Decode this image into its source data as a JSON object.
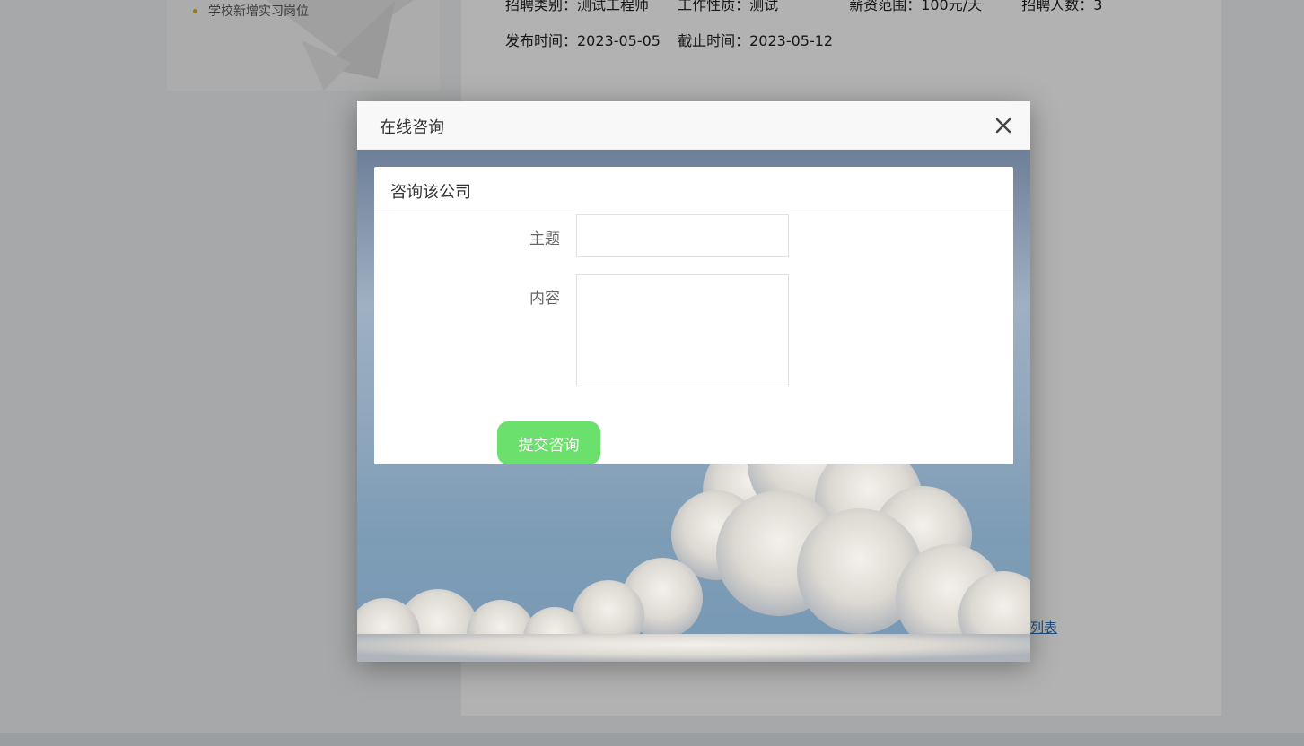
{
  "sidebar": {
    "items": [
      {
        "label": "学校新增实习岗位"
      }
    ]
  },
  "job_info": {
    "category": "招聘类别：测试工程师",
    "nature": "工作性质：测试",
    "salary": "薪资范围：100元/天",
    "headcount": "招聘人数：3",
    "publish_time": "发布时间：2023-05-05",
    "deadline": "截止时间：2023-05-12"
  },
  "list_link": "列表",
  "modal": {
    "title": "在线咨询",
    "close_icon": "close-icon",
    "form": {
      "title": "咨询该公司",
      "subject_label": "主题",
      "subject_value": "",
      "content_label": "内容",
      "content_value": "",
      "submit_label": "提交咨询"
    }
  },
  "colors": {
    "submit_button": "#6ce06c",
    "bullet": "#e2a91f",
    "link": "#2a6fb5"
  }
}
